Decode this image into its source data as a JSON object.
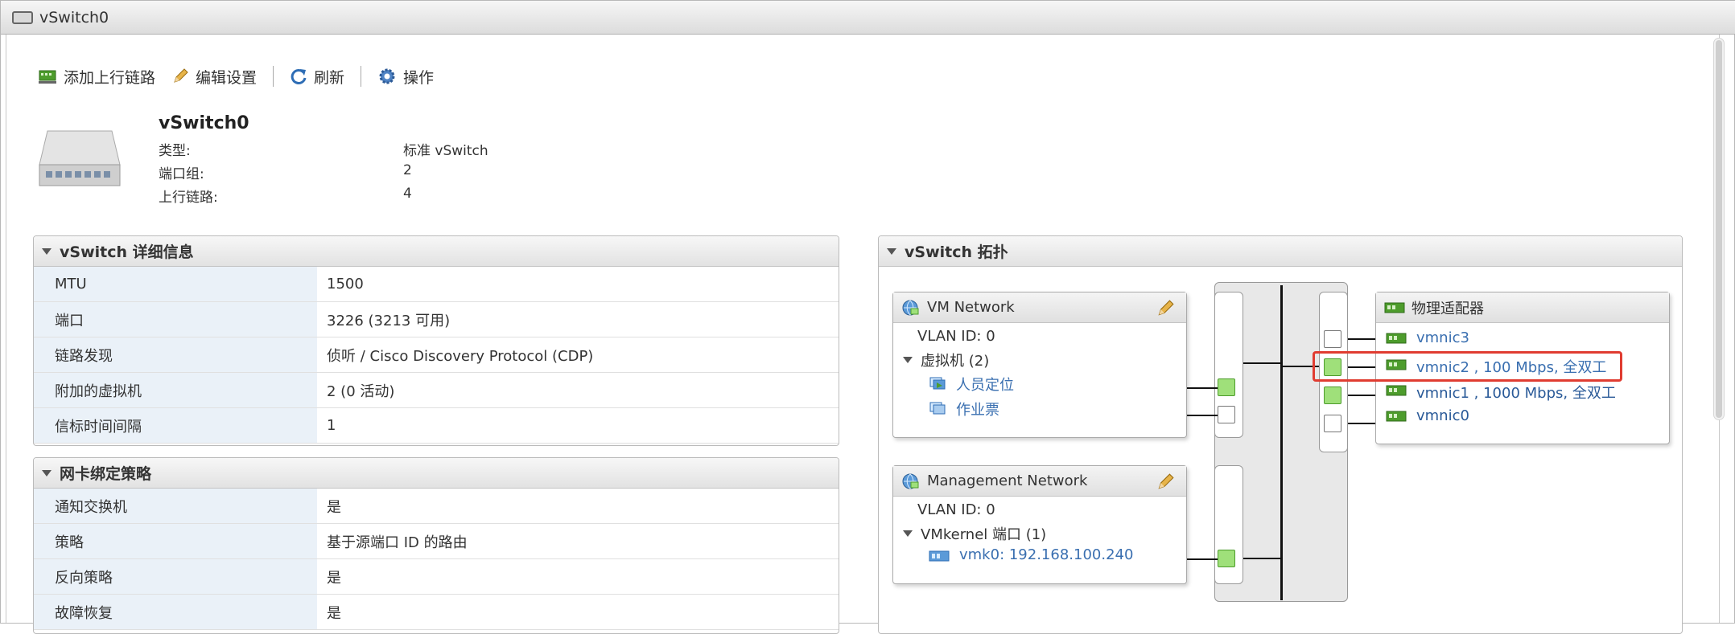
{
  "window": {
    "title": "vSwitch0"
  },
  "toolbar": {
    "add_uplink": "添加上行链路",
    "edit_settings": "编辑设置",
    "refresh": "刷新",
    "actions": "操作"
  },
  "summary": {
    "name": "vSwitch0",
    "rows": [
      {
        "label": "类型:",
        "value": "标准 vSwitch"
      },
      {
        "label": "端口组:",
        "value": "2"
      },
      {
        "label": "上行链路:",
        "value": "4"
      }
    ]
  },
  "details": {
    "title": "vSwitch 详细信息",
    "rows": [
      {
        "key": "MTU",
        "value": "1500"
      },
      {
        "key": "端口",
        "value": "3226 (3213 可用)"
      },
      {
        "key": "链路发现",
        "value": "侦听 / Cisco Discovery Protocol (CDP)"
      },
      {
        "key": "附加的虚拟机",
        "value": "2 (0 活动)"
      },
      {
        "key": "信标时间间隔",
        "value": "1"
      }
    ]
  },
  "teaming": {
    "title": "网卡绑定策略",
    "rows": [
      {
        "key": "通知交换机",
        "value": "是"
      },
      {
        "key": "策略",
        "value": "基于源端口 ID 的路由"
      },
      {
        "key": "反向策略",
        "value": "是"
      },
      {
        "key": "故障恢复",
        "value": "是"
      }
    ]
  },
  "topology": {
    "title": "vSwitch 拓扑",
    "vm_network": {
      "name": "VM Network",
      "vlan": "VLAN ID: 0",
      "group_label": "虚拟机 (2)",
      "items": [
        "人员定位",
        "作业票"
      ]
    },
    "mgmt_network": {
      "name": "Management Network",
      "vlan": "VLAN ID: 0",
      "group_label": "VMkernel 端口 (1)",
      "items": [
        "vmk0: 192.168.100.240"
      ]
    },
    "adapters": {
      "title": "物理适配器",
      "items": [
        "vmnic3",
        "vmnic2 , 100 Mbps, 全双工",
        "vmnic1 , 1000 Mbps, 全双工",
        "vmnic0"
      ]
    }
  },
  "colors": {
    "link": "#3a6fb0",
    "port_active": "#9fe07a",
    "highlight": "#e03c31"
  }
}
